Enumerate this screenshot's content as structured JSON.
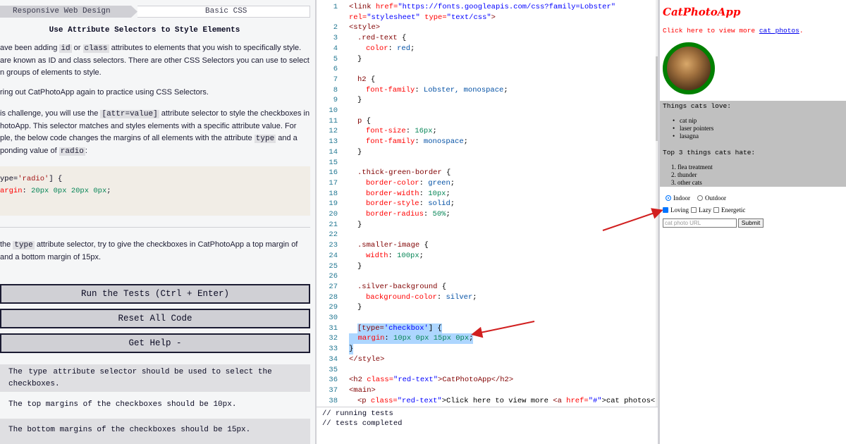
{
  "breadcrumb": {
    "course": "Responsive Web Design",
    "section": "Basic CSS"
  },
  "lesson": {
    "title": "Use Attribute Selectors to Style Elements",
    "p1_a": "ave been adding ",
    "p1_id": "id",
    "p1_or": " or ",
    "p1_class": "class",
    "p1_b": " attributes to elements that you wish to specifically style.",
    "p1_line2": "are known as ID and class selectors. There are other CSS Selectors you can use to select",
    "p1_line3": "n groups of elements to style.",
    "p2": "ring out CatPhotoApp again to practice using CSS Selectors.",
    "p3_a": "is challenge, you will use the ",
    "p3_code": "[attr=value]",
    "p3_b": " attribute selector to style the checkboxes in",
    "p3_line2": "hotoApp. This selector matches and styles elements with a specific attribute value. For",
    "p3_line3_a": "ple, the below code changes the margins of all elements with the attribute ",
    "p3_type": "type",
    "p3_line3_b": " and a",
    "p3_line4_a": "ponding value of ",
    "p3_radio": "radio",
    "p3_line4_b": ":",
    "code_line1_a": "ype=",
    "code_line1_str": "'radio'",
    "code_line1_b": "] {",
    "code_line2_prop": "argin",
    "code_line2_b": ": ",
    "code_line2_num": "20px 0px 20px 0px",
    "code_line2_c": ";",
    "task_a": " the ",
    "task_code": "type",
    "task_b": " attribute selector, try to give the checkboxes in CatPhotoApp a top margin of",
    "task_line2": "and a bottom margin of 15px."
  },
  "buttons": {
    "run": "Run the Tests (Ctrl + Enter)",
    "reset": "Reset All Code",
    "help": "Get Help -"
  },
  "tests": {
    "t1_a": "The ",
    "t1_code": "type",
    "t1_b": " attribute selector should be used to select the",
    "t1_line2": "checkboxes.",
    "t2": "The top margins of the checkboxes should be 10px.",
    "t3": "The bottom margins of the checkboxes should be 15px."
  },
  "editor": {
    "line_numbers": [
      "1",
      "",
      "2",
      "3",
      "4",
      "5",
      "6",
      "7",
      "8",
      "9",
      "10",
      "11",
      "12",
      "13",
      "14",
      "15",
      "16",
      "17",
      "18",
      "19",
      "20",
      "21",
      "22",
      "23",
      "24",
      "25",
      "26",
      "27",
      "28",
      "29",
      "30",
      "31",
      "32",
      "33",
      "34",
      "35",
      "36",
      "37",
      "38"
    ],
    "l1_tag": "<link",
    "l1_attr": " href=",
    "l1_str": "\"https://fonts.googleapis.com/css?family=Lobster\"",
    "l1b_attr": "rel=",
    "l1b_str1": "\"stylesheet\"",
    "l1b_attr2": " type=",
    "l1b_str2": "\"text/css\"",
    "l1b_end": ">",
    "l2": "<style>",
    "l3_sel": ".red-text",
    "l3_b": " {",
    "l4_prop": "color",
    "l4_val": "red",
    "close": "}",
    "l7_sel": "h2",
    "l8_prop": "font-family",
    "l8_val": "Lobster, monospace",
    "l11_sel": "p",
    "l12_prop": "font-size",
    "l12_val": "16px",
    "l13_prop": "font-family",
    "l13_val": "monospace",
    "l16_sel": ".thick-green-border",
    "l17_prop": "border-color",
    "l17_val": "green",
    "l18_prop": "border-width",
    "l18_val": "10px",
    "l19_prop": "border-style",
    "l19_val": "solid",
    "l20_prop": "border-radius",
    "l20_val": "50%",
    "l23_sel": ".smaller-image",
    "l24_prop": "width",
    "l24_val": "100px",
    "l27_sel": ".silver-background",
    "l28_prop": "background-color",
    "l28_val": "silver",
    "l31_a": "[type=",
    "l31_str": "'checkbox'",
    "l31_b": "] {",
    "l32_prop": "margin",
    "l32_val": "10px 0px 15px 0px",
    "l34": "</style>",
    "l36_tag": "<h2",
    "l36_attr": " class=",
    "l36_str": "\"red-text\"",
    "l36_text": ">CatPhotoApp</h2>",
    "l37": "<main>",
    "l38_tag": "<p",
    "l38_attr": " class=",
    "l38_str": "\"red-text\"",
    "l38_text": ">Click here to view more ",
    "l38_a": "<a",
    "l38_href": " href=",
    "l38_hstr": "\"#\"",
    "l38_end": ">cat photos</"
  },
  "console": {
    "line1": "// running tests",
    "line2": "// tests completed"
  },
  "preview": {
    "title": "CatPhotoApp",
    "text_a": "Click here to view more ",
    "text_link": "cat photos",
    "text_b": ".",
    "love_label": "Things cats love:",
    "love_items": [
      "cat nip",
      "laser pointers",
      "lasagna"
    ],
    "hate_label": "Top 3 things cats hate:",
    "hate_items": [
      "1. flea treatment",
      "2. thunder",
      "3. other cats"
    ],
    "radio_indoor": "Indoor",
    "radio_outdoor": "Outdoor",
    "check_loving": "Loving",
    "check_lazy": "Lazy",
    "check_energetic": "Energetic",
    "url_placeholder": "cat photo URL",
    "submit": "Submit"
  },
  "colors": {
    "arrow": "#d11f1f",
    "highlight": "#add6ff",
    "green_border": "#008000"
  }
}
